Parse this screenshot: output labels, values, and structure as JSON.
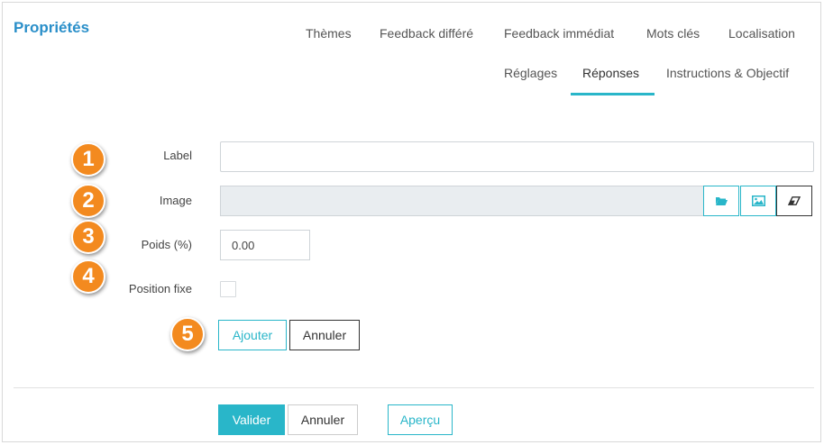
{
  "panel": {
    "title": "Propriétés"
  },
  "tabs_row1": [
    "Thèmes",
    "Feedback différé",
    "Feedback immédiat",
    "Mots clés",
    "Localisation"
  ],
  "tabs_row2": [
    "Réglages",
    "Réponses",
    "Instructions & Objectif"
  ],
  "active_tab": "Réponses",
  "form": {
    "label_label": "Label",
    "label_value": "",
    "image_label": "Image",
    "poids_label": "Poids (%)",
    "poids_value": "0.00",
    "position_label": "Position fixe",
    "position_checked": false,
    "add_button": "Ajouter",
    "cancel_button": "Annuler"
  },
  "badges": [
    "1",
    "2",
    "3",
    "4",
    "5"
  ],
  "footer": {
    "validate": "Valider",
    "cancel": "Annuler",
    "preview": "Aperçu"
  },
  "icons": {
    "browse": "folder-open-icon",
    "image": "image-icon",
    "clear": "eraser-icon"
  },
  "colors": {
    "accent": "#29b6c9",
    "title": "#2a8fc9",
    "badge": "#f38a1f"
  }
}
